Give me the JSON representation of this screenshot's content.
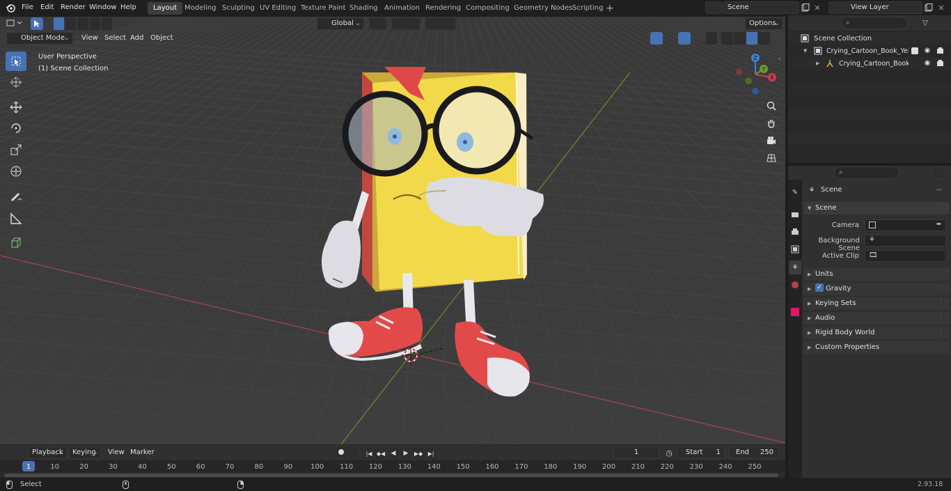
{
  "menu": [
    "File",
    "Edit",
    "Render",
    "Window",
    "Help"
  ],
  "workspaces": [
    "Layout",
    "Modeling",
    "Sculpting",
    "UV Editing",
    "Texture Paint",
    "Shading",
    "Animation",
    "Rendering",
    "Compositing",
    "Geometry Nodes",
    "Scripting"
  ],
  "active_workspace": "Layout",
  "scene_field": "Scene",
  "viewlayer_field": "View Layer",
  "viewport": {
    "mode": "Object Mode",
    "menus": [
      "View",
      "Select",
      "Add",
      "Object"
    ],
    "transform_orientation": "Global",
    "options": "Options",
    "overlay_line1": "User Perspective",
    "overlay_line2": "(1) Scene Collection",
    "gizmo_axes": {
      "x": "X",
      "y": "Y",
      "z": "Z"
    }
  },
  "outliner": {
    "root": "Scene Collection",
    "items": [
      {
        "label": "Crying_Cartoon_Book_Yellow"
      },
      {
        "label": "Crying_Cartoon_Book_Ye"
      }
    ]
  },
  "properties": {
    "context": "Scene",
    "section": "Scene",
    "fields": [
      {
        "label": "Camera"
      },
      {
        "label": "Background Scene"
      },
      {
        "label": "Active Clip"
      }
    ],
    "subsections": [
      "Units",
      "Gravity",
      "Keying Sets",
      "Audio",
      "Rigid Body World",
      "Custom Properties"
    ]
  },
  "timeline": {
    "menus": [
      "Playback",
      "Keying",
      "View",
      "Marker"
    ],
    "current_frame": "1",
    "start_label": "Start",
    "start": "1",
    "end_label": "End",
    "end": "250",
    "ticks": [
      "1",
      "10",
      "20",
      "30",
      "40",
      "50",
      "60",
      "70",
      "80",
      "90",
      "100",
      "110",
      "120",
      "130",
      "140",
      "150",
      "160",
      "170",
      "180",
      "190",
      "200",
      "210",
      "220",
      "230",
      "240",
      "250"
    ]
  },
  "status": {
    "left": "Select",
    "version": "2.93.18"
  },
  "colors": {
    "accent": "#4772b3",
    "x_axis": "#c9414b",
    "y_axis": "#6e9a2c",
    "z_axis": "#3c83d6",
    "book_yellow": "#f2d94a",
    "shoe_red": "#e04848"
  }
}
